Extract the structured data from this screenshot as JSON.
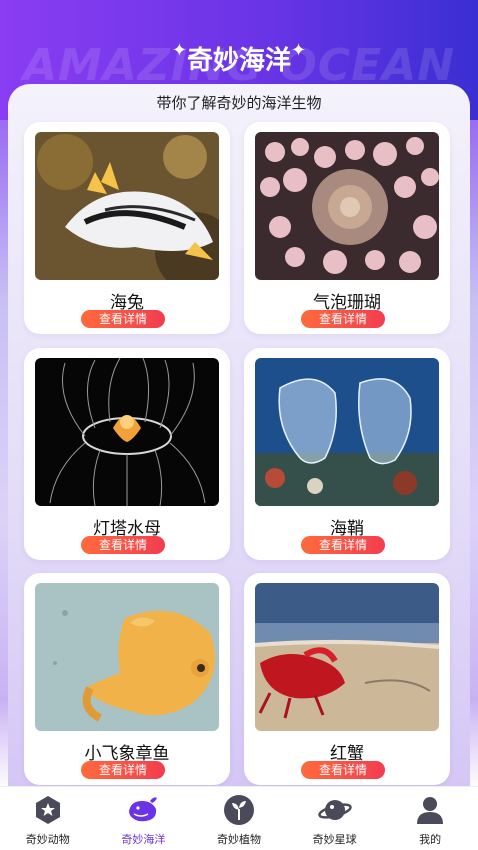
{
  "header": {
    "watermark": "AMAZING OCEAN",
    "title": "奇妙海洋",
    "sparkle_left": "✦",
    "sparkle_right": "✦",
    "subtitle": "带你了解奇妙的海洋生物"
  },
  "cards": [
    {
      "name": "海兔",
      "button": "查看详情",
      "image": "sea-slug-image"
    },
    {
      "name": "气泡珊瑚",
      "button": "查看详情",
      "image": "bubble-coral-image"
    },
    {
      "name": "灯塔水母",
      "button": "查看详情",
      "image": "immortal-jellyfish-image"
    },
    {
      "name": "海鞘",
      "button": "查看详情",
      "image": "sea-squirt-image"
    },
    {
      "name": "小飞象章鱼",
      "button": "查看详情",
      "image": "dumbo-octopus-image"
    },
    {
      "name": "红蟹",
      "button": "查看详情",
      "image": "red-crab-image"
    }
  ],
  "tabbar": {
    "active": "奇妙海洋",
    "colors": {
      "active": "#6a34e6",
      "inactive": "#5a5a6a"
    },
    "items": [
      {
        "label": "奇妙动物",
        "icon": "star-icon"
      },
      {
        "label": "奇妙海洋",
        "icon": "whale-icon"
      },
      {
        "label": "奇妙植物",
        "icon": "sprout-icon"
      },
      {
        "label": "奇妙星球",
        "icon": "planet-icon"
      },
      {
        "label": "我的",
        "icon": "user-icon"
      }
    ]
  }
}
